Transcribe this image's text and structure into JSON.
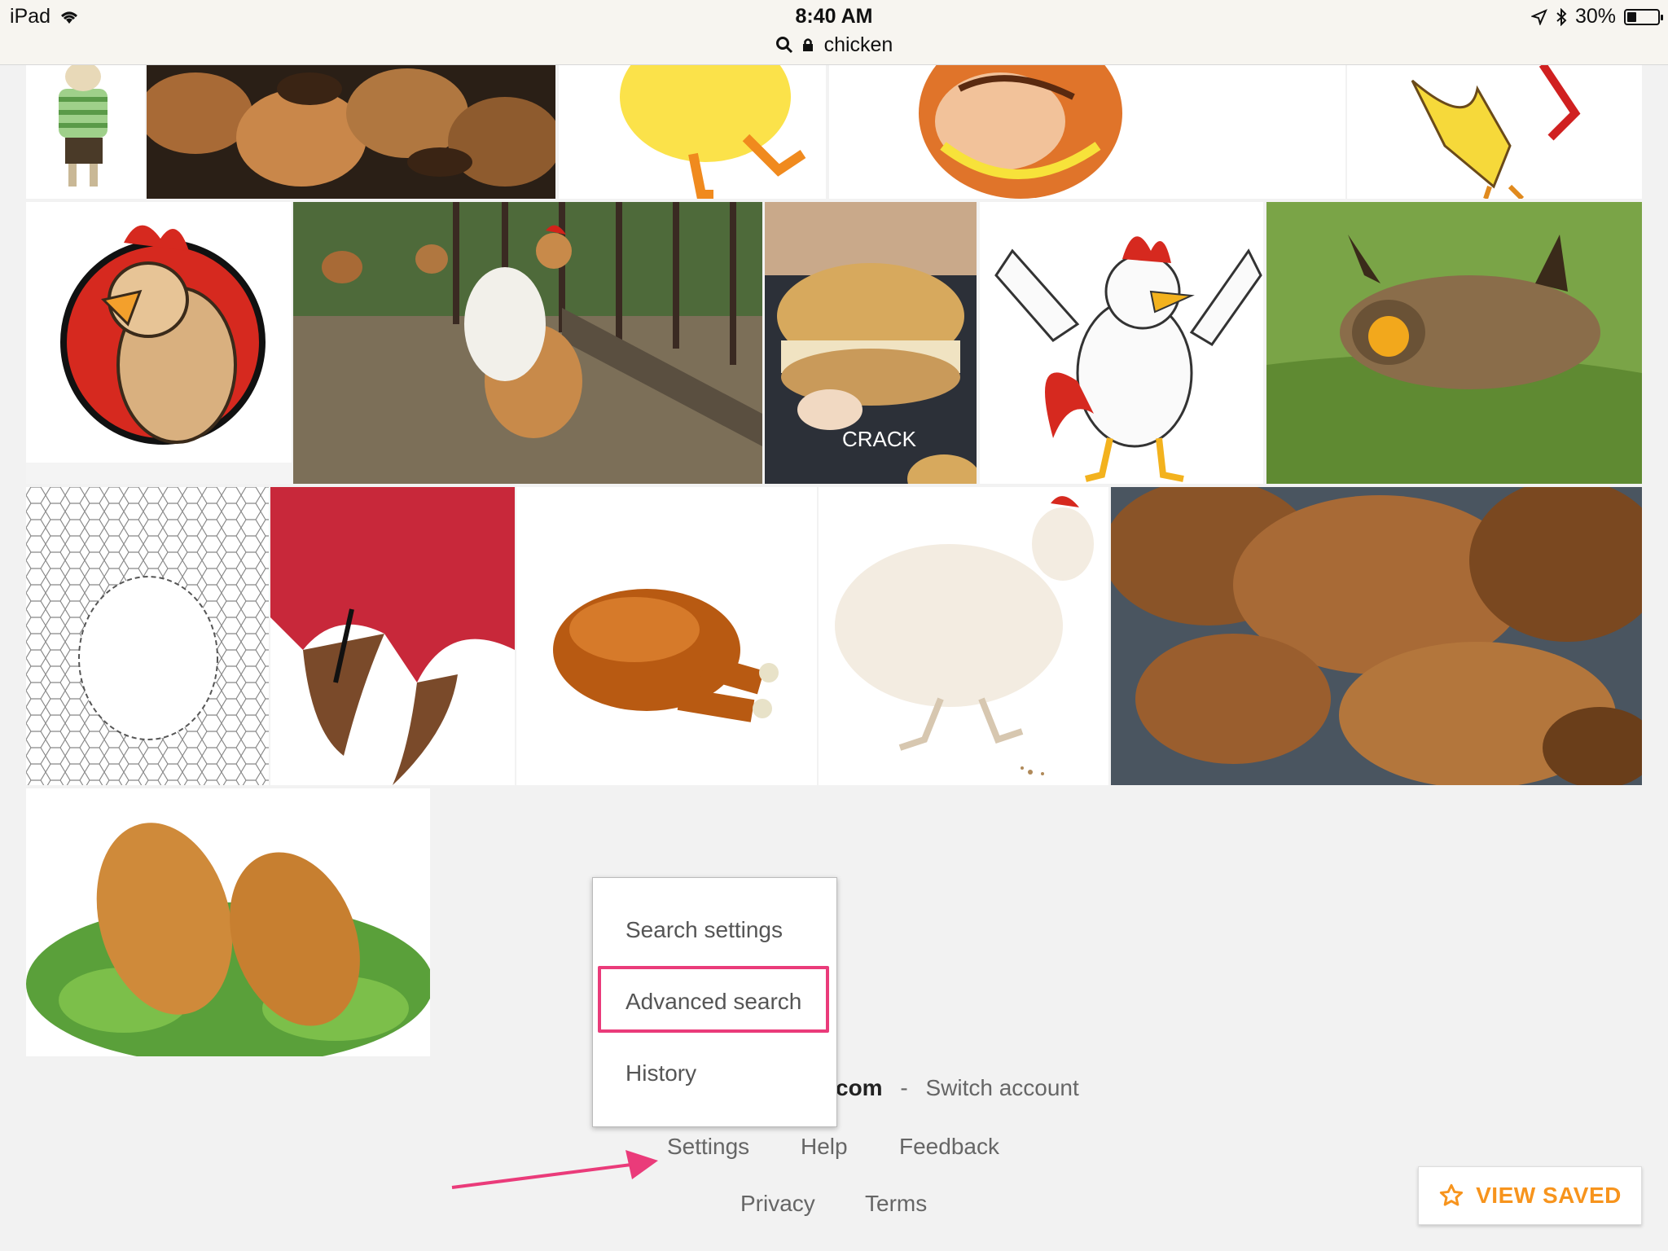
{
  "status_bar": {
    "device": "iPad",
    "time": "8:40 AM",
    "url": "chicken",
    "battery": "30%",
    "battery_level": 0.3,
    "icons": [
      "wifi-icon",
      "search-icon",
      "lock-icon",
      "location-arrow-icon",
      "bluetooth-icon",
      "battery-icon"
    ]
  },
  "results": {
    "tiles": [
      "cartoon-boy",
      "grilled-chicken",
      "cartoon-chick-legs",
      "painted-chicken",
      "yellow-bird",
      "rooster-logo",
      "rooster-in-yard",
      "crack-chicken-sandwich",
      "cartoon-rooster",
      "prairie-chicken",
      "chicken-wire",
      "rooster-feet",
      "roast-chicken-3d",
      "white-hen",
      "fried-chicken-pieces",
      "fried-chicken-salad"
    ],
    "watermark_text": "CRACK"
  },
  "menu": {
    "items": [
      "Search settings",
      "Advanced search",
      "History"
    ],
    "highlighted": "Advanced search"
  },
  "footer": {
    "account_suffix": "com",
    "separator": "-",
    "switch_account": "Switch account",
    "settings": "Settings",
    "help": "Help",
    "feedback": "Feedback",
    "privacy": "Privacy",
    "terms": "Terms"
  },
  "view_saved": {
    "label": "VIEW SAVED",
    "icon": "star-outline-icon"
  },
  "colors": {
    "accent_orange": "#f7941d",
    "annotation_pink": "#ea3b7a"
  }
}
